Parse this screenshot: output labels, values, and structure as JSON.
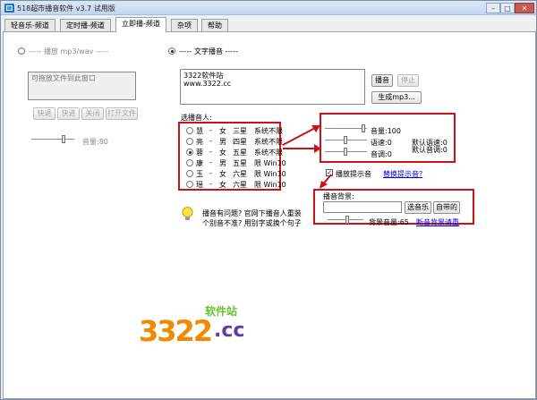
{
  "window": {
    "title": "518超市播音软件 v3.7 试用版",
    "controls": {
      "minimize": "–",
      "maximize": "□",
      "close": "✕"
    }
  },
  "tabs": [
    {
      "label": "轻音乐-频道"
    },
    {
      "label": "定时播-频道"
    },
    {
      "label": "立即播-频道"
    },
    {
      "label": "杂项"
    },
    {
      "label": "帮助"
    }
  ],
  "left": {
    "radio_label": "----- 播放 mp3/wav -----",
    "drop_placeholder": "可拖放文件到此窗口",
    "buttons": [
      "快退",
      "快进",
      "关闭",
      "打开文件"
    ],
    "volume_label": "音量:80",
    "volume_value": 80
  },
  "tts": {
    "radio_label": "----- 文字播音 -----",
    "text_line1": "3322软件站",
    "text_line2": "www.3322.cc",
    "play_label": "播音",
    "stop_label": "停止",
    "generate_label": "生成mp3..."
  },
  "voices": {
    "header": "选播音人:",
    "items": [
      {
        "name": "慧",
        "gender": "女",
        "stars": "三星",
        "note": "系统不限",
        "selected": false
      },
      {
        "name": "亮",
        "gender": "男",
        "stars": "四星",
        "note": "系统不限",
        "selected": false
      },
      {
        "name": "蓉",
        "gender": "女",
        "stars": "五星",
        "note": "系统不限",
        "selected": true
      },
      {
        "name": "康",
        "gender": "男",
        "stars": "五星",
        "note": "限 Win10",
        "selected": false
      },
      {
        "name": "玉",
        "gender": "女",
        "stars": "六星",
        "note": "限 Win10",
        "selected": false
      },
      {
        "name": "瑶",
        "gender": "女",
        "stars": "六星",
        "note": "限 Win10",
        "selected": false
      }
    ],
    "separator": "-"
  },
  "params": {
    "volume_label": "音量:100",
    "volume_value": 100,
    "speed_label": "语速:0",
    "pitch_label": "音调:0",
    "default_speed": "默认语速:0",
    "default_pitch": "默认音调:0"
  },
  "prompt": {
    "checkbox_label": "播放提示音",
    "checked": true,
    "link_label": "替换提示音?"
  },
  "background": {
    "label": "播音背景:",
    "input_value": "",
    "choose_label": "选音乐",
    "builtin_label": "自带的",
    "volume_label": "背景音量:65",
    "volume_value": 65,
    "link_label": "断音背景请重"
  },
  "tip": {
    "line1": "播音有问题? 官网下播音人重装",
    "line2": "个别音不准? 用别字或换个句子"
  },
  "logo": {
    "top_text": "软件站",
    "main_text": "3322",
    "suffix_text": ".cc"
  },
  "colors": {
    "highlight_red": "#d01018",
    "logo_orange": "#f08a00",
    "logo_purple": "#5a3ea6",
    "logo_green": "#6abf2e"
  }
}
